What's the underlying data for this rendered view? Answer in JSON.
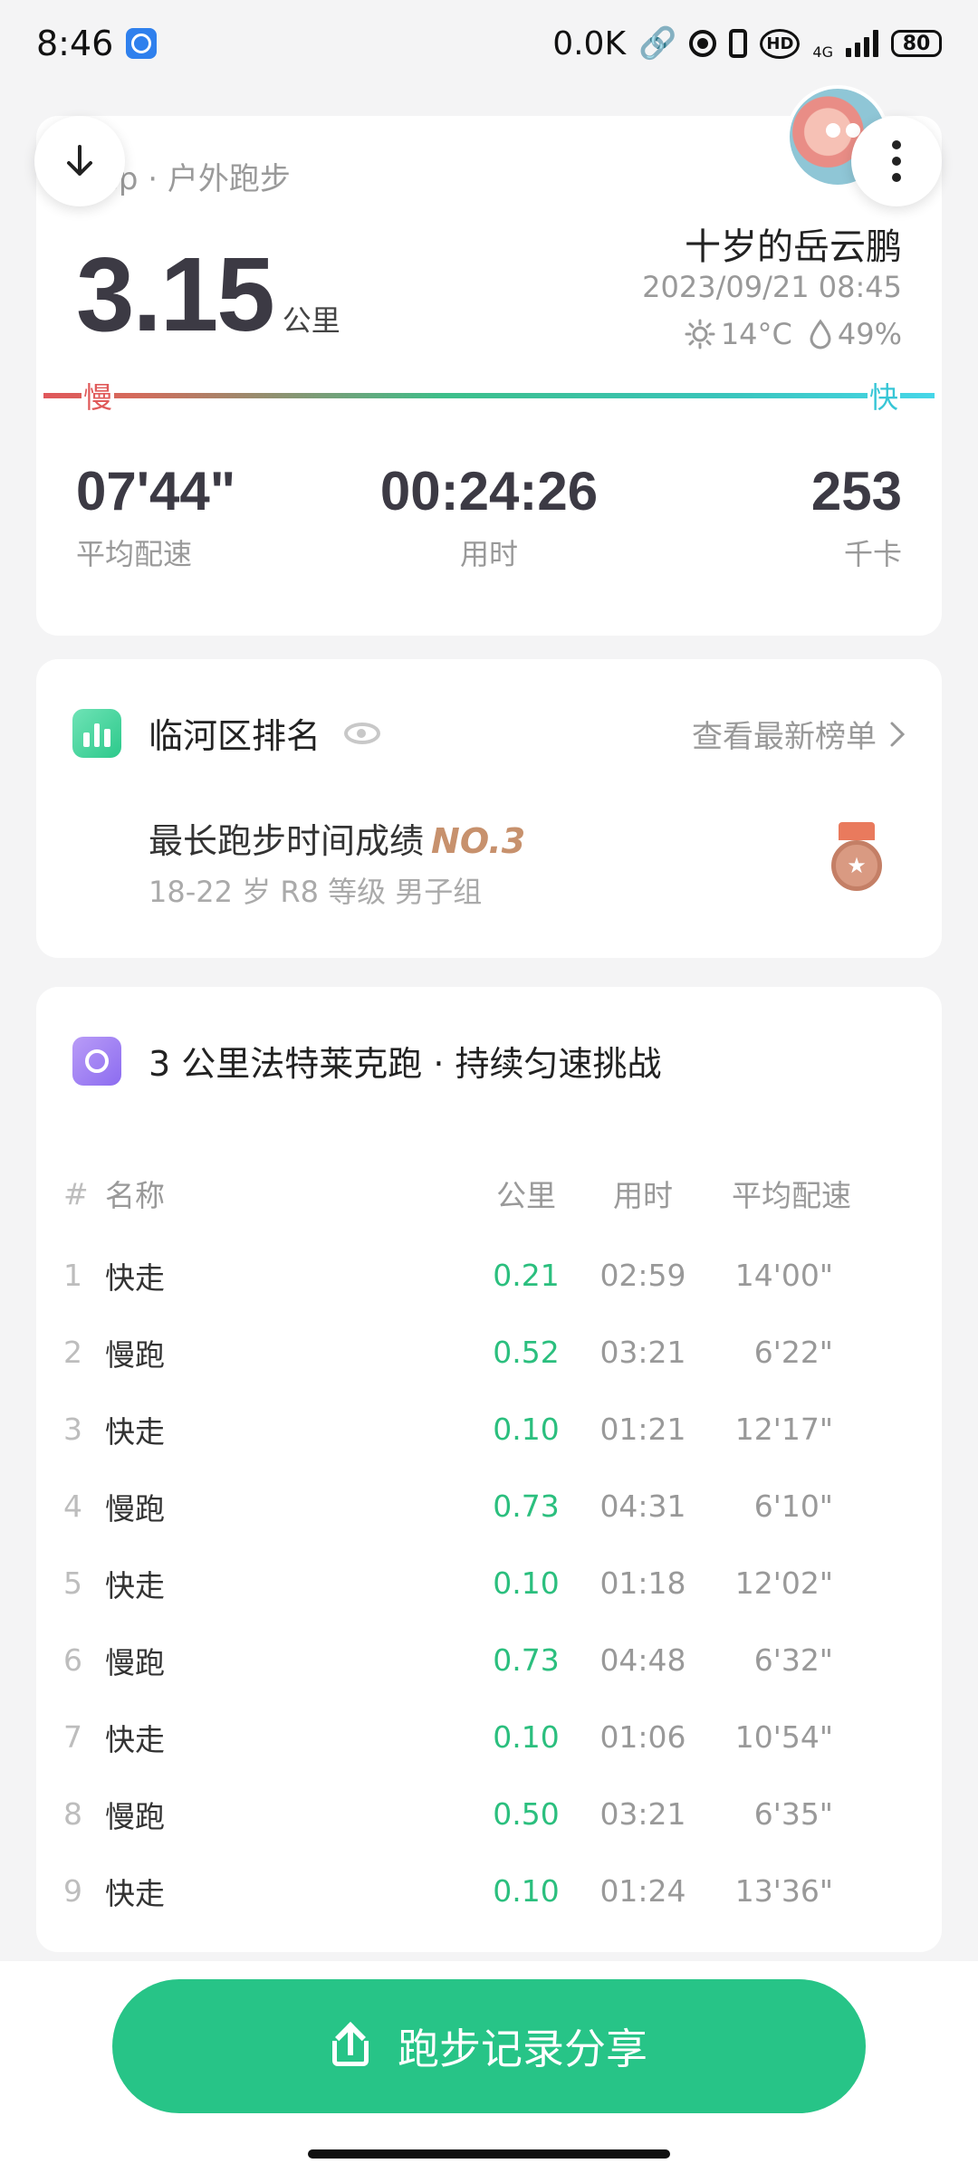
{
  "status_bar": {
    "time": "8:46",
    "net_speed": "0.0K",
    "network": "4G",
    "battery": "80"
  },
  "summary": {
    "subtitle": "ep · 户外跑步",
    "distance": "3.15",
    "distance_unit": "公里",
    "user_name": "十岁的岳云鹏",
    "datetime": "2023/09/21 08:45",
    "temperature": "14°C",
    "humidity": "49%",
    "slow_label": "慢",
    "fast_label": "快",
    "stats": [
      {
        "value": "07'44\"",
        "label": "平均配速"
      },
      {
        "value": "00:24:26",
        "label": "用时"
      },
      {
        "value": "253",
        "label": "千卡"
      }
    ]
  },
  "ranking": {
    "title": "临河区排名",
    "link": "查看最新榜单",
    "achievement": "最长跑步时间成绩",
    "rank": "NO.3",
    "details": "18-22 岁 R8 等级 男子组",
    "medal_icon": "medal-icon"
  },
  "challenge": {
    "title": "3 公里法特莱克跑 · 持续匀速挑战",
    "headers": [
      "#",
      "名称",
      "公里",
      "用时",
      "平均配速"
    ],
    "rows": [
      [
        "1",
        "快走",
        "0.21",
        "02:59",
        "14'00\""
      ],
      [
        "2",
        "慢跑",
        "0.52",
        "03:21",
        "6'22\""
      ],
      [
        "3",
        "快走",
        "0.10",
        "01:21",
        "12'17\""
      ],
      [
        "4",
        "慢跑",
        "0.73",
        "04:31",
        "6'10\""
      ],
      [
        "5",
        "快走",
        "0.10",
        "01:18",
        "12'02\""
      ],
      [
        "6",
        "慢跑",
        "0.73",
        "04:48",
        "6'32\""
      ],
      [
        "7",
        "快走",
        "0.10",
        "01:06",
        "10'54\""
      ],
      [
        "8",
        "慢跑",
        "0.50",
        "03:21",
        "6'35\""
      ],
      [
        "9",
        "快走",
        "0.10",
        "01:24",
        "13'36\""
      ]
    ]
  },
  "share_button": "跑步记录分享",
  "colors": {
    "accent": "#27c487",
    "slow": "#e0575b",
    "fast": "#46d6e8",
    "rank_gold": "#c7916d"
  }
}
